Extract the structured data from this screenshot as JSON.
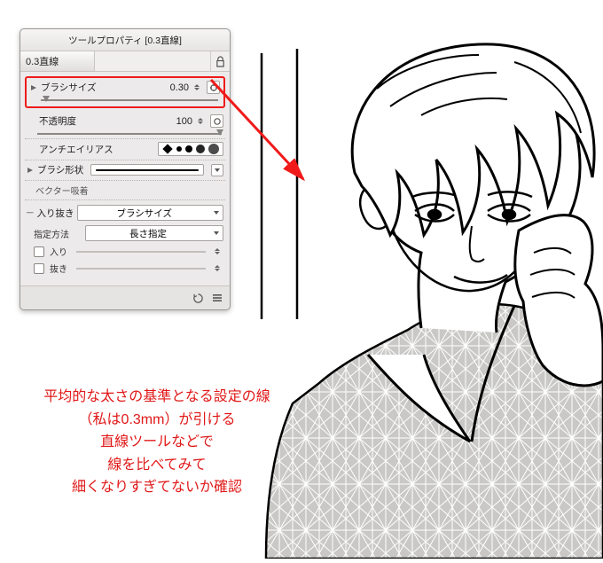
{
  "panel": {
    "title": "ツールプロパティ [0.3直線]",
    "preset_name": "0.3直線"
  },
  "props": {
    "brush_size_label": "ブラシサイズ",
    "brush_size_value": "0.30",
    "opacity_label": "不透明度",
    "opacity_value": "100",
    "antialias_label": "アンチエイリアス",
    "brush_shape_label": "ブラシ形状",
    "vector_snap_label": "ベクター吸着"
  },
  "inout": {
    "section_label": "入り抜き",
    "mode_value": "ブラシサイズ",
    "method_label": "指定方法",
    "method_value": "長さ指定",
    "in_label": "入り",
    "out_label": "抜き"
  },
  "caption": {
    "l1": "平均的な太さの基準となる設定の線",
    "l2": "（私は0.3mm）が引ける",
    "l3": "直線ツールなどで",
    "l4": "線を比べてみて",
    "l5": "細くなりすぎてないか確認"
  }
}
